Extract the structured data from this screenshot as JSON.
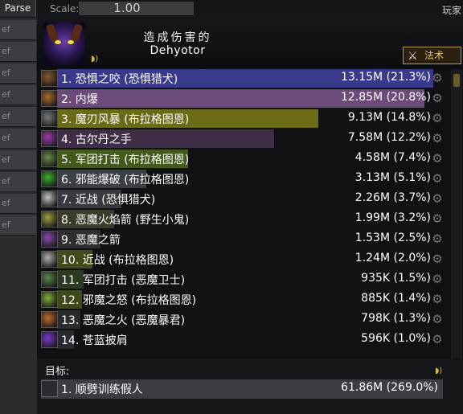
{
  "topbar": {
    "parse_tab": "Parse",
    "scale_label": "Scale:",
    "scale_value": "1.00",
    "corner_text": "玩家"
  },
  "left_column": {
    "row_labels": [
      "ef",
      "ef",
      "ef",
      "ef",
      "ef",
      "ef",
      "ef",
      "ef",
      "ef",
      "ef"
    ]
  },
  "header": {
    "caption": "造成伤害的",
    "name": "Dehyotor",
    "mode_button": "法术",
    "speaker_icon": "speaker-icon"
  },
  "abilities": [
    {
      "label": "1. 恐惧之咬 (恐惧猎犬)",
      "value": "13.15M (21.3%)",
      "fill": 1.0,
      "bar_color": "#3a3a8c",
      "icon_color": "#8a5a2a"
    },
    {
      "label": "2. 内爆",
      "value": "12.85M (20.8%)",
      "fill": 0.977,
      "bar_color": "#6c4a79",
      "icon_color": "#b06a2a"
    },
    {
      "label": "3. 魔刃风暴 (布拉格图恩)",
      "value": "9.13M (14.8%)",
      "fill": 0.694,
      "bar_color": "#6b6a16",
      "icon_color": "#7c7a7a"
    },
    {
      "label": "4. 古尔丹之手",
      "value": "7.58M (12.2%)",
      "fill": 0.576,
      "bar_color": "#3f2e45",
      "icon_color": "#a03ab0"
    },
    {
      "label": "5. 军团打击 (布拉格图恩)",
      "value": "4.58M (7.4%)",
      "fill": 0.348,
      "bar_color": "#445a1c",
      "icon_color": "#6a8a4a"
    },
    {
      "label": "6. 邪能爆破 (布拉格图恩)",
      "value": "3.13M (5.1%)",
      "fill": 0.238,
      "bar_color": "#3c3f43",
      "icon_color": "#3ab02a"
    },
    {
      "label": "7. 近战 (恐惧猎犬)",
      "value": "2.26M (3.7%)",
      "fill": 0.172,
      "bar_color": "#373a3e",
      "icon_color": "#c0c0c0"
    },
    {
      "label": "8. 恶魔火焰箭 (野生小鬼)",
      "value": "1.99M (3.2%)",
      "fill": 0.151,
      "bar_color": "#3b3d2a",
      "icon_color": "#a0a040"
    },
    {
      "label": "9. 恶魔之箭",
      "value": "1.53M (2.5%)",
      "fill": 0.116,
      "bar_color": "#2e2f33",
      "icon_color": "#8a4ab0"
    },
    {
      "label": "10. 近战 (布拉格图恩)",
      "value": "1.24M (2.0%)",
      "fill": 0.094,
      "bar_color": "#454a1c",
      "icon_color": "#b0b0b0"
    },
    {
      "label": "11. 军团打击 (恶魔卫士)",
      "value": "935K (1.5%)",
      "fill": 0.071,
      "bar_color": "#2e3a22",
      "icon_color": "#5a8a4a"
    },
    {
      "label": "12. 邪魔之怒 (布拉格图恩)",
      "value": "885K (1.4%)",
      "fill": 0.067,
      "bar_color": "#3f4a1a",
      "icon_color": "#7ab03a"
    },
    {
      "label": "13. 恶魔之火 (恶魔暴君)",
      "value": "798K (1.3%)",
      "fill": 0.061,
      "bar_color": "#2c2c30",
      "icon_color": "#c06a2a"
    },
    {
      "label": "14. 苍蓝披肩",
      "value": "596K (1.0%)",
      "fill": 0.045,
      "bar_color": "#2a2a32",
      "icon_color": "#7a3ad0"
    }
  ],
  "target": {
    "label": "目标:",
    "row_label": "1. 顺劈训练假人",
    "row_value": "61.86M (269.0%)"
  }
}
